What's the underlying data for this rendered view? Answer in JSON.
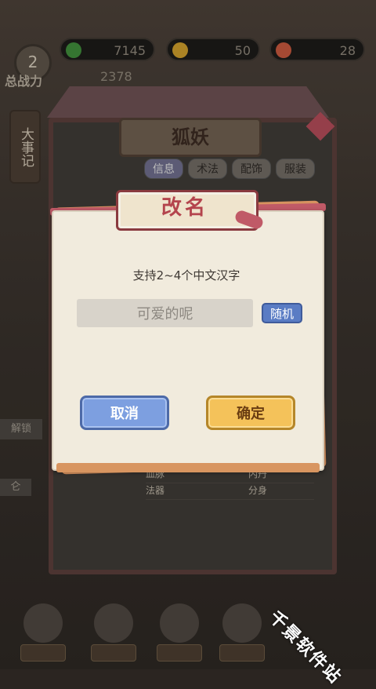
{
  "background": {
    "resources": [
      {
        "icon": "jade-icon",
        "value": "7145",
        "color": "#3f8a3a"
      },
      {
        "icon": "gold-icon",
        "value": "50",
        "color": "#c99a2b"
      },
      {
        "icon": "peach-icon",
        "value": "28",
        "color": "#c2563d"
      }
    ],
    "level": "2",
    "power_label": "总战力",
    "power_value": "2378",
    "side_tab": "大事记",
    "panel_title": "狐妖",
    "tabs": [
      "信息",
      "术法",
      "配饰",
      "服装"
    ],
    "left_label_1": "解锁",
    "left_label_2": "仑",
    "attributes": [
      {
        "left": "血脉",
        "right": "内丹"
      },
      {
        "left": "法器",
        "right": "分身"
      }
    ],
    "nav_items": [
      "",
      "",
      "",
      "",
      ""
    ]
  },
  "dialog": {
    "title": "改名",
    "hint": "支持2~4个中文汉字",
    "name_value": "可爱的呢",
    "random_label": "随机",
    "cancel_label": "取消",
    "confirm_label": "确定"
  },
  "watermark": "千景软件站",
  "colors": {
    "accent_red": "#b4444d",
    "cancel_blue": "#7d9fe0",
    "confirm_gold": "#f4c25a"
  }
}
